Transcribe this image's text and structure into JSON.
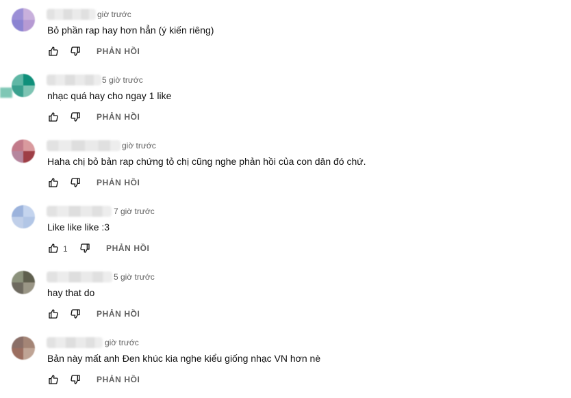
{
  "comments": [
    {
      "time": "giờ trước",
      "text": "Bỏ phần rap hay hơn hẳn (ý kiến riêng)",
      "likes": "",
      "reply": "PHẢN HỒI",
      "avatar_colors": [
        "#9b8fd6",
        "#c8b0dc",
        "#8b84d2",
        "#b69ad3"
      ]
    },
    {
      "time": "5 giờ trước",
      "text": "nhạc quá hay cho ngay 1 like",
      "likes": "",
      "reply": "PHẢN HỒI",
      "avatar_colors": [
        "#5fb7a5",
        "#0f8f7a",
        "#3aa08e",
        "#7dc4b3"
      ]
    },
    {
      "time": "giờ trước",
      "text": "Haha chị bỏ bản rap chứng tỏ chị cũng nghe phản hồi của con dân đó chứ.",
      "likes": "",
      "reply": "PHẢN HỒI",
      "avatar_colors": [
        "#c27a8a",
        "#d99a9e",
        "#b5869e",
        "#9e3e46"
      ]
    },
    {
      "time": "7 giờ trước",
      "text": "Like like like :3",
      "likes": "1",
      "reply": "PHẢN HỒI",
      "avatar_colors": [
        "#9cb3dc",
        "#c4d4ee",
        "#c0cfe9",
        "#b2c6e6"
      ]
    },
    {
      "time": "5 giờ trước",
      "text": "hay that do",
      "likes": "",
      "reply": "PHẢN HỒI",
      "avatar_colors": [
        "#8c927c",
        "#5f5f4e",
        "#6e6a60",
        "#9a9686"
      ]
    },
    {
      "time": "giờ trước",
      "text": "Bản này mất anh Đen khúc kia nghe kiểu giống nhạc VN hơn nè",
      "likes": "",
      "reply": "PHẢN HỒI",
      "avatar_colors": [
        "#8a6f68",
        "#a48576",
        "#9b6e60",
        "#bfa495"
      ]
    }
  ],
  "icons": {
    "like": "thumbs-up-icon",
    "dislike": "thumbs-down-icon"
  }
}
